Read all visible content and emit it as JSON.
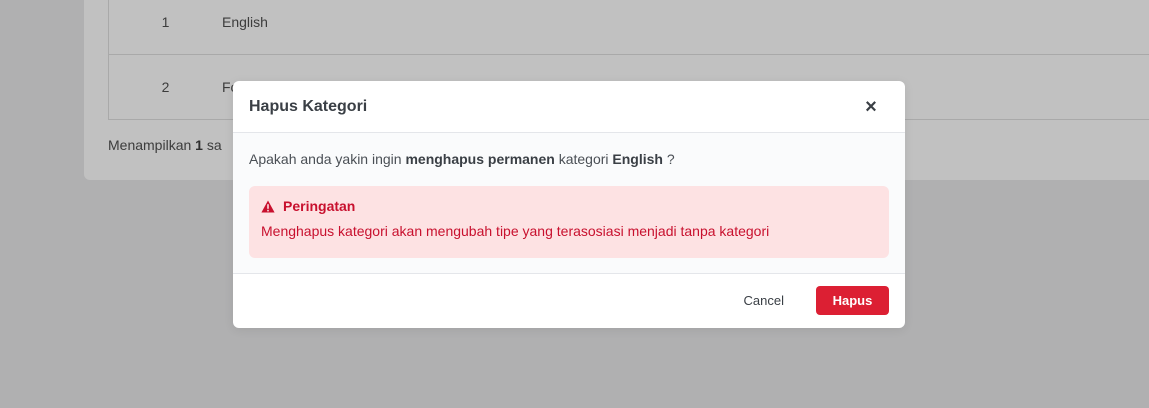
{
  "background": {
    "rows": [
      {
        "num": "1",
        "name": "English"
      },
      {
        "num": "2",
        "name": "Fo"
      }
    ],
    "footer_prefix": "Menampilkan",
    "footer_bold": "1",
    "footer_suffix": "sa"
  },
  "modal": {
    "title": "Hapus Kategori",
    "close_icon": "×",
    "question": {
      "part1": "Apakah anda yakin ingin",
      "bold1": "menghapus permanen",
      "part2": "kategori",
      "bold2": "English",
      "part3": "?"
    },
    "alert": {
      "icon": "warning-triangle-icon",
      "title": "Peringatan",
      "text": "Menghapus kategori akan mengubah tipe yang terasosiasi menjadi tanpa kategori"
    },
    "cancel_label": "Cancel",
    "delete_label": "Hapus"
  },
  "colors": {
    "danger": "#dc1f33",
    "alert_bg": "#fde2e3",
    "alert_text": "#c8102e",
    "overlay": "#b0b0b1"
  }
}
